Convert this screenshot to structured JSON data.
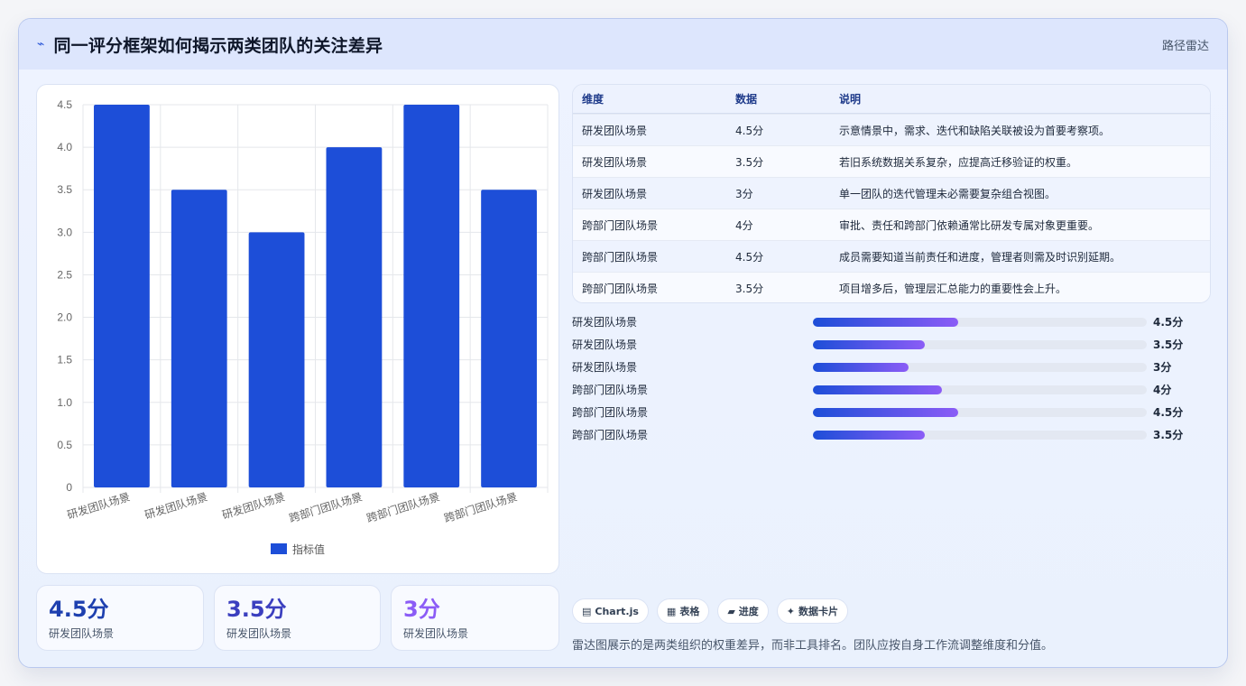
{
  "header": {
    "logo_icon": "pulse-icon",
    "title": "同一评分框架如何揭示两类团队的关注差异",
    "tag": "路径雷达"
  },
  "chart_data": {
    "type": "bar",
    "categories": [
      "研发团队场景",
      "研发团队场景",
      "研发团队场景",
      "跨部门团队场景",
      "跨部门团队场景",
      "跨部门团队场景"
    ],
    "series": [
      {
        "name": "指标值",
        "values": [
          4.5,
          3.5,
          3,
          4,
          4.5,
          3.5
        ]
      }
    ],
    "ylim": [
      0,
      4.5
    ],
    "yticks": [
      "0",
      "0.5",
      "1.0",
      "1.5",
      "2.0",
      "2.5",
      "3.0",
      "3.5",
      "4.0",
      "4.5"
    ],
    "legend": "bottom",
    "grid": true,
    "bar_color": "#1d4ed8"
  },
  "stats": [
    {
      "value": "4.5分",
      "label": "研发团队场景",
      "color": "#1e40af"
    },
    {
      "value": "3.5分",
      "label": "研发团队场景",
      "color": "#3b3fbf"
    },
    {
      "value": "3分",
      "label": "研发团队场景",
      "color": "#8b5cf6"
    }
  ],
  "table": {
    "headers": [
      "维度",
      "数据",
      "说明"
    ],
    "rows": [
      [
        "研发团队场景",
        "4.5分",
        "示意情景中，需求、迭代和缺陷关联被设为首要考察项。"
      ],
      [
        "研发团队场景",
        "3.5分",
        "若旧系统数据关系复杂，应提高迁移验证的权重。"
      ],
      [
        "研发团队场景",
        "3分",
        "单一团队的迭代管理未必需要复杂组合视图。"
      ],
      [
        "跨部门团队场景",
        "4分",
        "审批、责任和跨部门依赖通常比研发专属对象更重要。"
      ],
      [
        "跨部门团队场景",
        "4.5分",
        "成员需要知道当前责任和进度，管理者则需及时识别延期。"
      ],
      [
        "跨部门团队场景",
        "3.5分",
        "项目增多后，管理层汇总能力的重要性会上升。"
      ]
    ]
  },
  "progress": [
    {
      "label": "研发团队场景",
      "value": "4.5分",
      "fraction": 0.4352
    },
    {
      "label": "研发团队场景",
      "value": "3.5分",
      "fraction": 0.3352
    },
    {
      "label": "研发团队场景",
      "value": "3分",
      "fraction": 0.2852
    },
    {
      "label": "跨部门团队场景",
      "value": "4分",
      "fraction": 0.3852
    },
    {
      "label": "跨部门团队场景",
      "value": "4.5分",
      "fraction": 0.4352
    },
    {
      "label": "跨部门团队场景",
      "value": "3.5分",
      "fraction": 0.3352
    }
  ],
  "chips": [
    {
      "icon": "chart-icon",
      "glyph": "▤",
      "label": "Chart.js"
    },
    {
      "icon": "table-icon",
      "glyph": "▦",
      "label": "表格"
    },
    {
      "icon": "progress-icon",
      "glyph": "▰",
      "label": "进度"
    },
    {
      "icon": "sparkle-icon",
      "glyph": "✦",
      "label": "数据卡片"
    }
  ],
  "footnote": "雷达图展示的是两类组织的权重差异，而非工具排名。团队应按自身工作流调整维度和分值。"
}
